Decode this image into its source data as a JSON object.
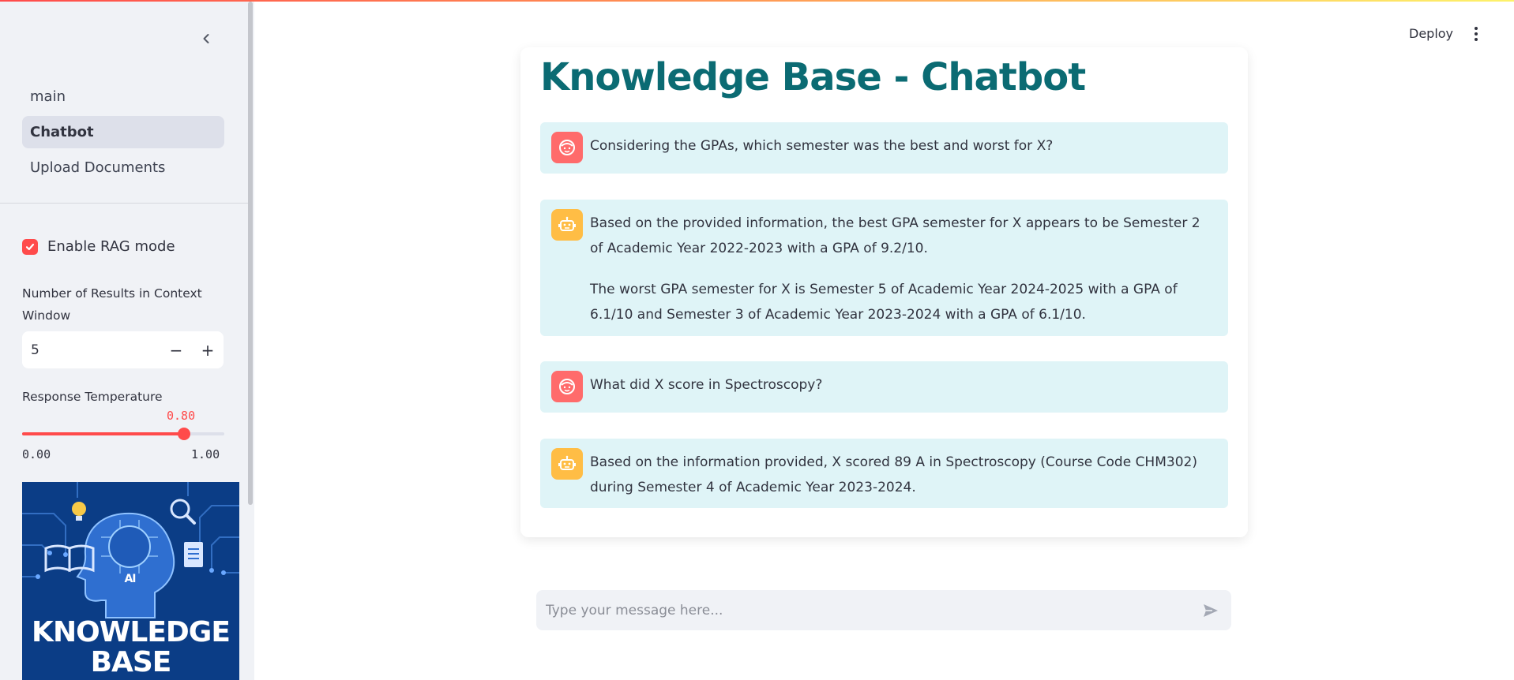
{
  "header": {
    "deploy_label": "Deploy"
  },
  "sidebar": {
    "nav": [
      {
        "label": "main",
        "active": false
      },
      {
        "label": "Chatbot",
        "active": true
      },
      {
        "label": "Upload Documents",
        "active": false
      }
    ],
    "rag_mode": {
      "label": "Enable RAG mode",
      "checked": true
    },
    "context_results": {
      "label": "Number of Results in Context Window",
      "value": "5",
      "decrement": "−",
      "increment": "+"
    },
    "temperature": {
      "label": "Response Temperature",
      "value": "0.80",
      "min": "0.00",
      "max": "1.00",
      "fraction": 0.8
    },
    "image": {
      "text_line1": "KNOWLEDGE",
      "text_line2": "BASE",
      "badge": "AI"
    }
  },
  "main": {
    "title": "Knowledge Base - Chatbot",
    "messages": [
      {
        "role": "user",
        "paragraphs": [
          "Considering the GPAs, which semester was the best and worst for X?"
        ]
      },
      {
        "role": "assistant",
        "paragraphs": [
          "Based on the provided information, the best GPA semester for X appears to be Semester 2 of Academic Year 2022-2023 with a GPA of 9.2/10.",
          "The worst GPA semester for X is Semester 5 of Academic Year 2024-2025 with a GPA of 6.1/10 and Semester 3 of Academic Year 2023-2024 with a GPA of 6.1/10."
        ]
      },
      {
        "role": "user",
        "paragraphs": [
          "What did X score in Spectroscopy?"
        ]
      },
      {
        "role": "assistant",
        "paragraphs": [
          "Based on the information provided, X scored 89 A in Spectroscopy (Course Code CHM302) during Semester 4 of Academic Year 2023-2024."
        ]
      }
    ]
  },
  "chat_input": {
    "placeholder": "Type your message here..."
  },
  "colors": {
    "accent": "#ff4b4b",
    "title": "#0b6b73",
    "message_bg": "#dff4f7",
    "user_avatar": "#ff6b6b",
    "bot_avatar": "#ffbd45"
  }
}
